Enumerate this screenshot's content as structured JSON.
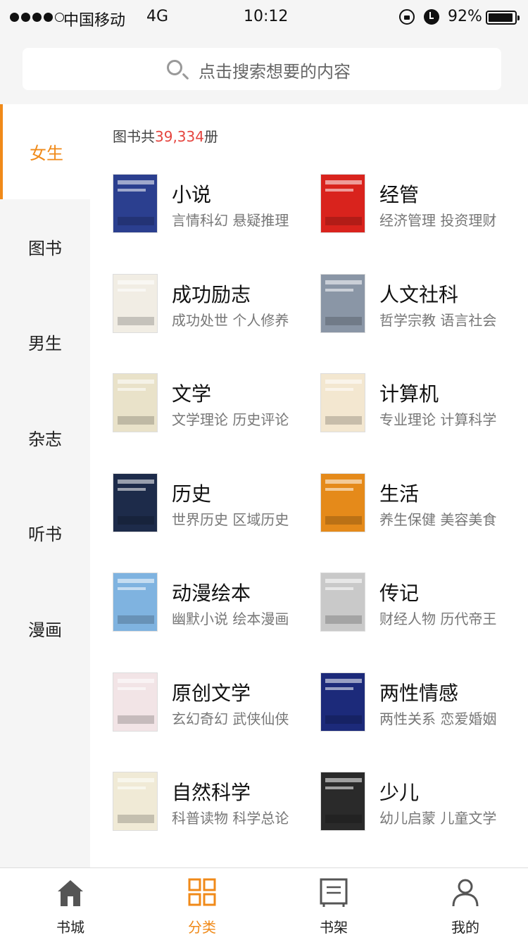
{
  "status_bar": {
    "carrier": "中国移动",
    "network": "4G",
    "time": "10:12",
    "battery": "92%"
  },
  "search": {
    "placeholder": "点击搜索想要的内容"
  },
  "sidebar": {
    "items": [
      {
        "label": "女生",
        "active": true
      },
      {
        "label": "图书",
        "active": false
      },
      {
        "label": "男生",
        "active": false
      },
      {
        "label": "杂志",
        "active": false
      },
      {
        "label": "听书",
        "active": false
      },
      {
        "label": "漫画",
        "active": false
      }
    ]
  },
  "count": {
    "prefix": "图书共",
    "number": "39,334",
    "suffix": "册"
  },
  "categories": [
    {
      "title": "小说",
      "sub": "言情科幻 悬疑推理",
      "cover_color": "#2b3f8f"
    },
    {
      "title": "经管",
      "sub": "经济管理 投资理财",
      "cover_color": "#d9231d"
    },
    {
      "title": "成功励志",
      "sub": "成功处世 个人修养",
      "cover_color": "#f1ede4"
    },
    {
      "title": "人文社科",
      "sub": "哲学宗教 语言社会",
      "cover_color": "#8a96a6"
    },
    {
      "title": "文学",
      "sub": "文学理论 历史评论",
      "cover_color": "#e9e2c9"
    },
    {
      "title": "计算机",
      "sub": "专业理论 计算科学",
      "cover_color": "#f3e7d0"
    },
    {
      "title": "历史",
      "sub": "世界历史 区域历史",
      "cover_color": "#1d2b4a"
    },
    {
      "title": "生活",
      "sub": "养生保健 美容美食",
      "cover_color": "#e58a1a"
    },
    {
      "title": "动漫绘本",
      "sub": "幽默小说 绘本漫画",
      "cover_color": "#7fb3e0"
    },
    {
      "title": "传记",
      "sub": "财经人物 历代帝王",
      "cover_color": "#c9c9c9"
    },
    {
      "title": "原创文学",
      "sub": "玄幻奇幻 武侠仙侠",
      "cover_color": "#f2e4e6"
    },
    {
      "title": "两性情感",
      "sub": "两性关系 恋爱婚姻",
      "cover_color": "#1c2a7a"
    },
    {
      "title": "自然科学",
      "sub": "科普读物 科学总论",
      "cover_color": "#f0ead6"
    },
    {
      "title": "少儿",
      "sub": "幼儿启蒙 儿童文学",
      "cover_color": "#2a2a2a"
    }
  ],
  "tabbar": {
    "tabs": [
      {
        "label": "书城",
        "icon": "home-icon",
        "active": false
      },
      {
        "label": "分类",
        "icon": "grid-icon",
        "active": true
      },
      {
        "label": "书架",
        "icon": "bookshelf-icon",
        "active": false
      },
      {
        "label": "我的",
        "icon": "profile-icon",
        "active": false
      }
    ]
  },
  "colors": {
    "accent": "#f08a19",
    "count_number": "#e5453f"
  }
}
